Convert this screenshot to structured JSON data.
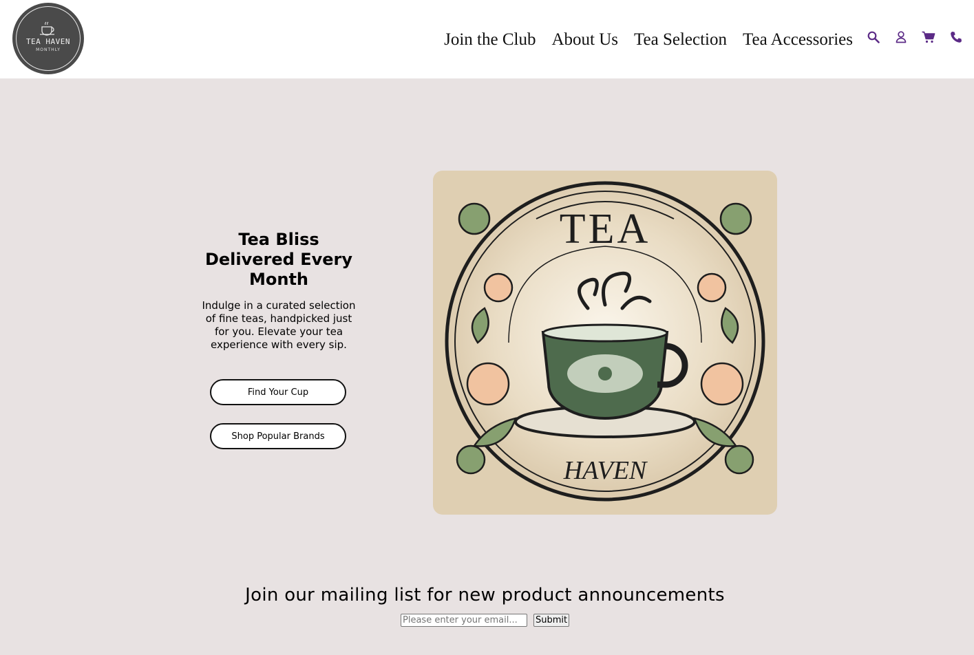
{
  "logo": {
    "title": "TEA HAVEN",
    "subtitle": "MONTHLY"
  },
  "nav": {
    "links": [
      "Join the Club",
      "About Us",
      "Tea Selection",
      "Tea Accessories"
    ],
    "icons": [
      "search-icon",
      "user-icon",
      "cart-icon",
      "phone-icon"
    ],
    "icon_color": "#5b2a86"
  },
  "hero": {
    "title": "Tea Bliss Delivered Every Month",
    "description": "Indulge in a curated selection of fine teas, handpicked just for you. Elevate your tea experience with every sip.",
    "buttons": [
      "Find Your Cup",
      "Shop Popular Brands"
    ],
    "image_text_top": "TEA",
    "image_text_bottom": "HAVEN"
  },
  "mailing": {
    "title": "Join our mailing list for new product announcements",
    "placeholder": "Please enter your email...",
    "submit_label": "Submit"
  },
  "colors": {
    "background": "#e8e2e2",
    "header": "#ffffff",
    "image_bg": "#dfcfb2"
  }
}
